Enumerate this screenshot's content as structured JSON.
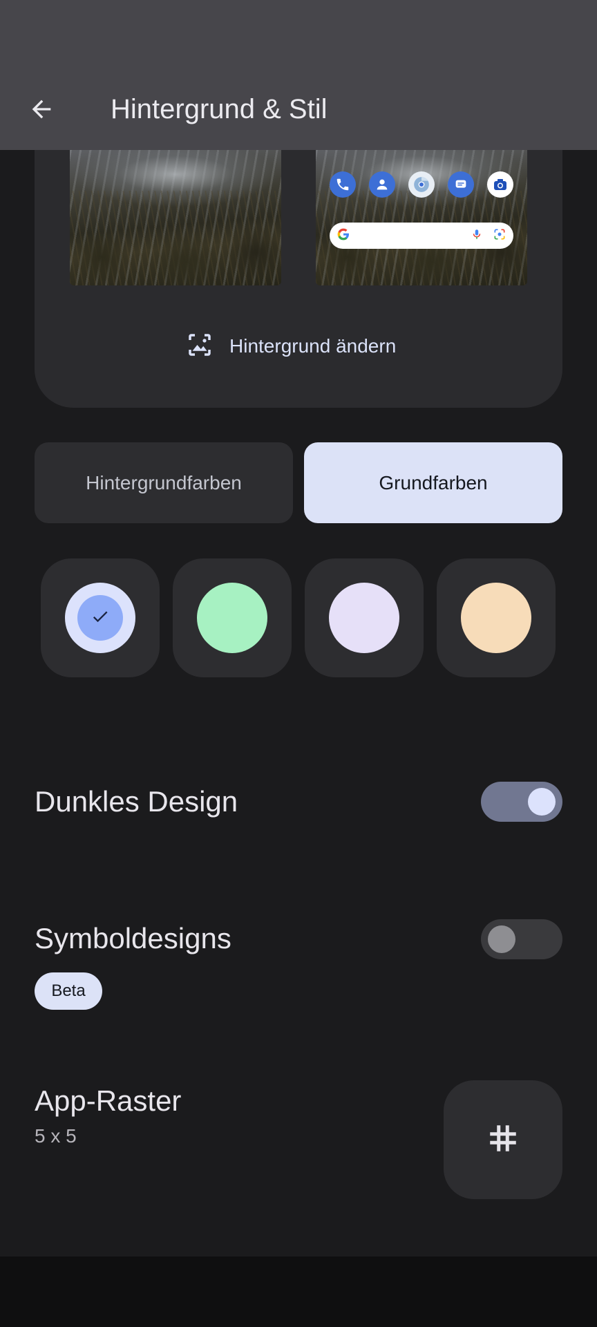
{
  "header": {
    "title": "Hintergrund & Stil",
    "back_icon": "arrow-back-icon"
  },
  "wallpaper": {
    "change_label": "Hintergrund ändern",
    "change_icon": "wallpaper-edit-icon",
    "home_dock_icons": [
      "phone-icon",
      "contacts-icon",
      "chrome-icon",
      "messages-icon",
      "camera-icon"
    ]
  },
  "color_tabs": {
    "wallpaper_colors": "Hintergrundfarben",
    "basic_colors": "Grundfarben",
    "selected": "Grundfarben"
  },
  "swatches": [
    {
      "name": "blue",
      "color": "#8eabf8",
      "outer": "#dce2fc",
      "selected": true
    },
    {
      "name": "green",
      "color": "#a7f1c2",
      "selected": false
    },
    {
      "name": "lavender",
      "color": "#e6e0f8",
      "selected": false
    },
    {
      "name": "peach",
      "color": "#f7dcb9",
      "selected": false
    }
  ],
  "settings": {
    "dark_theme": {
      "label": "Dunkles Design",
      "enabled": true
    },
    "themed_icons": {
      "label": "Symboldesigns",
      "badge": "Beta",
      "enabled": false
    },
    "app_grid": {
      "label": "App-Raster",
      "value": "5 x 5",
      "icon": "grid-icon"
    }
  },
  "colors": {
    "background": "#1b1b1d",
    "appbar": "#47464b",
    "card": "#2b2b2e",
    "accent": "#dce2f7"
  }
}
